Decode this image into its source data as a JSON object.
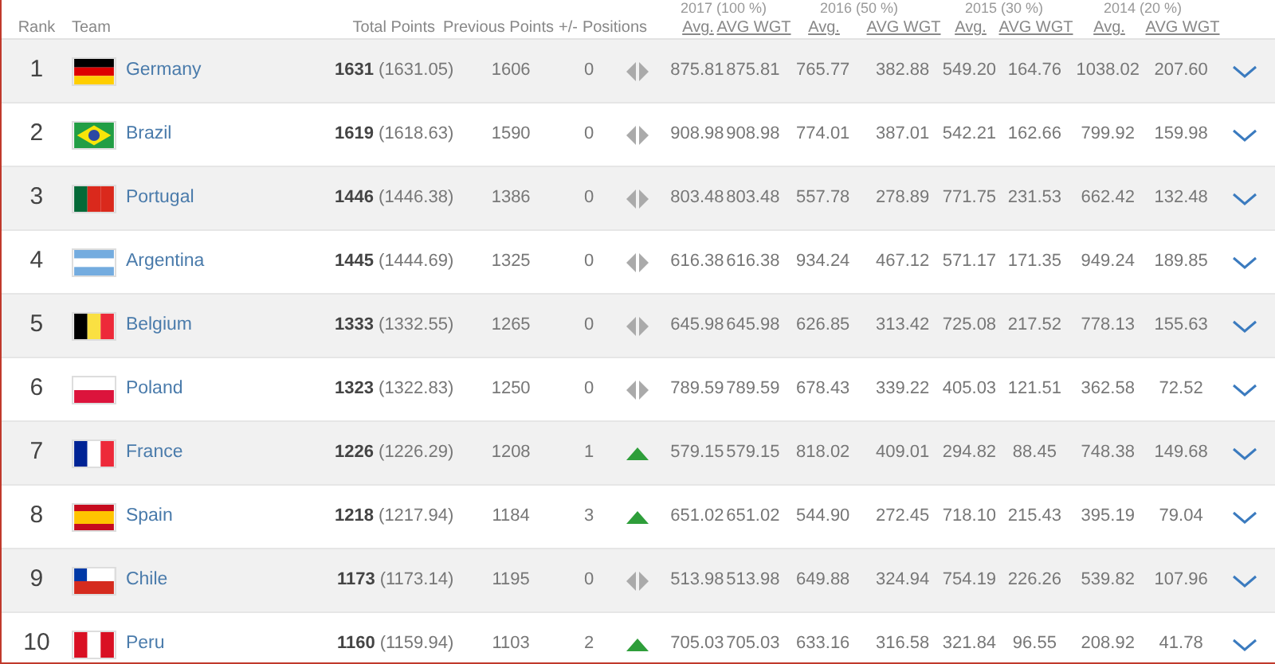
{
  "year_groups": [
    "2017 (100 %)",
    "2016 (50 %)",
    "2015 (30 %)",
    "2014 (20 %)"
  ],
  "columns": [
    "Rank",
    "Team",
    "Total Points",
    "Previous Points",
    "+/-",
    "Positions"
  ],
  "value_columns": [
    "Avg.",
    "AVG WGT",
    "Avg.",
    "AVG WGT",
    "Avg.",
    "AVG WGT",
    "Avg.",
    "AVG WGT"
  ],
  "rows": [
    {
      "rank": "1",
      "team": "Germany",
      "flag": {
        "kind": "horizontal",
        "stripes": [
          {
            "color": "#000000"
          },
          {
            "color": "#dd0000"
          },
          {
            "color": "#ffce00"
          }
        ]
      },
      "total": "1631",
      "total_exact": "(1631.05)",
      "previous": "1606",
      "change": "0",
      "movement": {
        "kind": "same"
      },
      "values": [
        "875.81",
        "875.81",
        "765.77",
        "382.88",
        "549.20",
        "164.76",
        "1038.02",
        "207.60"
      ]
    },
    {
      "rank": "2",
      "team": "Brazil",
      "flag": {
        "kind": "diamond",
        "stripes": [
          {
            "color": "#229e45"
          },
          {
            "color": "#f8e509"
          },
          {
            "color": "#2b49a3"
          }
        ]
      },
      "total": "1619",
      "total_exact": "(1618.63)",
      "previous": "1590",
      "change": "0",
      "movement": {
        "kind": "same"
      },
      "values": [
        "908.98",
        "908.98",
        "774.01",
        "387.01",
        "542.21",
        "162.66",
        "799.92",
        "159.98"
      ]
    },
    {
      "rank": "3",
      "team": "Portugal",
      "flag": {
        "kind": "vertical",
        "stripes": [
          {
            "color": "#046a38"
          },
          {
            "color": "#da291c"
          },
          {
            "color": "#da291c"
          }
        ]
      },
      "total": "1446",
      "total_exact": "(1446.38)",
      "previous": "1386",
      "change": "0",
      "movement": {
        "kind": "same"
      },
      "values": [
        "803.48",
        "803.48",
        "557.78",
        "278.89",
        "771.75",
        "231.53",
        "662.42",
        "132.48"
      ]
    },
    {
      "rank": "4",
      "team": "Argentina",
      "flag": {
        "kind": "horizontal",
        "stripes": [
          {
            "color": "#74acdf"
          },
          {
            "color": "#ffffff"
          },
          {
            "color": "#74acdf"
          }
        ]
      },
      "total": "1445",
      "total_exact": "(1444.69)",
      "previous": "1325",
      "change": "0",
      "movement": {
        "kind": "same"
      },
      "values": [
        "616.38",
        "616.38",
        "934.24",
        "467.12",
        "571.17",
        "171.35",
        "949.24",
        "189.85"
      ]
    },
    {
      "rank": "5",
      "team": "Belgium",
      "flag": {
        "kind": "vertical",
        "stripes": [
          {
            "color": "#000000"
          },
          {
            "color": "#fae042"
          },
          {
            "color": "#ed2939"
          }
        ]
      },
      "total": "1333",
      "total_exact": "(1332.55)",
      "previous": "1265",
      "change": "0",
      "movement": {
        "kind": "same"
      },
      "values": [
        "645.98",
        "645.98",
        "626.85",
        "313.42",
        "725.08",
        "217.52",
        "778.13",
        "155.63"
      ]
    },
    {
      "rank": "6",
      "team": "Poland",
      "flag": {
        "kind": "horizontal",
        "stripes": [
          {
            "color": "#ffffff"
          },
          {
            "color": "#dc143c"
          }
        ]
      },
      "total": "1323",
      "total_exact": "(1322.83)",
      "previous": "1250",
      "change": "0",
      "movement": {
        "kind": "same"
      },
      "values": [
        "789.59",
        "789.59",
        "678.43",
        "339.22",
        "405.03",
        "121.51",
        "362.58",
        "72.52"
      ]
    },
    {
      "rank": "7",
      "team": "France",
      "flag": {
        "kind": "vertical",
        "stripes": [
          {
            "color": "#002395"
          },
          {
            "color": "#ffffff"
          },
          {
            "color": "#ed2939"
          }
        ]
      },
      "total": "1226",
      "total_exact": "(1226.29)",
      "previous": "1208",
      "change": "1",
      "movement": {
        "kind": "up"
      },
      "values": [
        "579.15",
        "579.15",
        "818.02",
        "409.01",
        "294.82",
        "88.45",
        "748.38",
        "149.68"
      ]
    },
    {
      "rank": "8",
      "team": "Spain",
      "flag": {
        "kind": "horizontal",
        "stripes": [
          {
            "color": "#c60b1e"
          },
          {
            "color": "#ffc400"
          },
          {
            "color": "#ffc400"
          },
          {
            "color": "#c60b1e"
          }
        ]
      },
      "total": "1218",
      "total_exact": "(1217.94)",
      "previous": "1184",
      "change": "3",
      "movement": {
        "kind": "up"
      },
      "values": [
        "651.02",
        "651.02",
        "544.90",
        "272.45",
        "718.10",
        "215.43",
        "395.19",
        "79.04"
      ]
    },
    {
      "rank": "9",
      "team": "Chile",
      "flag": {
        "kind": "canton",
        "stripes": [
          {
            "color": "#0039a6"
          },
          {
            "color": "#ffffff"
          },
          {
            "color": "#d52b1e"
          }
        ]
      },
      "total": "1173",
      "total_exact": "(1173.14)",
      "previous": "1195",
      "change": "0",
      "movement": {
        "kind": "same"
      },
      "values": [
        "513.98",
        "513.98",
        "649.88",
        "324.94",
        "754.19",
        "226.26",
        "539.82",
        "107.96"
      ]
    },
    {
      "rank": "10",
      "team": "Peru",
      "flag": {
        "kind": "vertical",
        "stripes": [
          {
            "color": "#d91023"
          },
          {
            "color": "#ffffff"
          },
          {
            "color": "#d91023"
          }
        ]
      },
      "total": "1160",
      "total_exact": "(1159.94)",
      "previous": "1103",
      "change": "2",
      "movement": {
        "kind": "up"
      },
      "values": [
        "705.03",
        "705.03",
        "633.16",
        "316.58",
        "321.84",
        "96.55",
        "208.92",
        "41.78"
      ]
    }
  ]
}
